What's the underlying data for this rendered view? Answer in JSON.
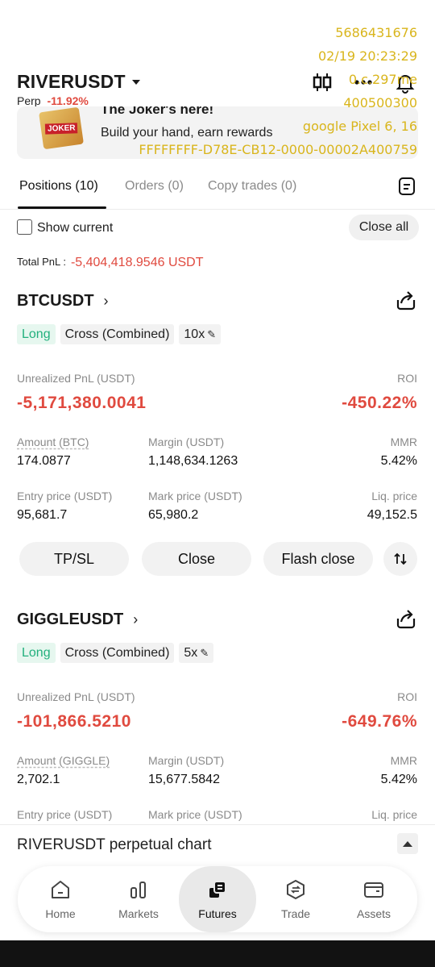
{
  "header": {
    "pair": "RIVERUSDT",
    "contract_type": "Perp",
    "change": "-11.92%"
  },
  "watermark": {
    "line1": "5686431676",
    "line2": "02/19 20:23:29",
    "line3": "0.c.297me",
    "line4": "400500300",
    "line5": "google Pixel 6, 16",
    "line6": "FFFFFFFF-D78E-CB12-0000-00002A400759"
  },
  "banner": {
    "title": "The Joker's here!",
    "subtitle": "Build your hand, earn rewards",
    "image_text": "JOKER"
  },
  "tabs": [
    {
      "label": "Positions (10)"
    },
    {
      "label": "Orders (0)"
    },
    {
      "label": "Copy trades (0)"
    }
  ],
  "filters": {
    "show_current": "Show current",
    "close_all": "Close all",
    "total_pnl_label": "Total PnL :",
    "total_pnl_value": "-5,404,418.9546 USDT"
  },
  "positions": [
    {
      "symbol": "BTCUSDT",
      "side": "Long",
      "margin_mode": "Cross (Combined)",
      "leverage": "10x",
      "unrealized_label": "Unrealized PnL (USDT)",
      "unrealized_value": "-5,171,380.0041",
      "roi_label": "ROI",
      "roi_value": "-450.22%",
      "amount_label": "Amount (BTC)",
      "amount_value": "174.0877",
      "margin_label": "Margin (USDT)",
      "margin_value": "1,148,634.1263",
      "mmr_label": "MMR",
      "mmr_value": "5.42%",
      "entry_label": "Entry price (USDT)",
      "entry_value": "95,681.7",
      "mark_label": "Mark price (USDT)",
      "mark_value": "65,980.2",
      "liq_label": "Liq. price",
      "liq_value": "49,152.5",
      "btn_tpsl": "TP/SL",
      "btn_close": "Close",
      "btn_flash": "Flash close"
    },
    {
      "symbol": "GIGGLEUSDT",
      "side": "Long",
      "margin_mode": "Cross (Combined)",
      "leverage": "5x",
      "unrealized_label": "Unrealized PnL (USDT)",
      "unrealized_value": "-101,866.5210",
      "roi_label": "ROI",
      "roi_value": "-649.76%",
      "amount_label": "Amount (GIGGLE)",
      "amount_value": "2,702.1",
      "margin_label": "Margin (USDT)",
      "margin_value": "15,677.5842",
      "mmr_label": "MMR",
      "mmr_value": "5.42%",
      "entry_label": "Entry price (USDT)",
      "mark_label": "Mark price (USDT)",
      "liq_label": "Liq. price"
    }
  ],
  "chart_bar": {
    "title": "RIVERUSDT perpetual chart"
  },
  "nav": [
    {
      "label": "Home"
    },
    {
      "label": "Markets"
    },
    {
      "label": "Futures"
    },
    {
      "label": "Trade"
    },
    {
      "label": "Assets"
    }
  ],
  "colors": {
    "negative": "#e04a3f",
    "long": "#22b07d",
    "watermark": "#d9b51c"
  }
}
